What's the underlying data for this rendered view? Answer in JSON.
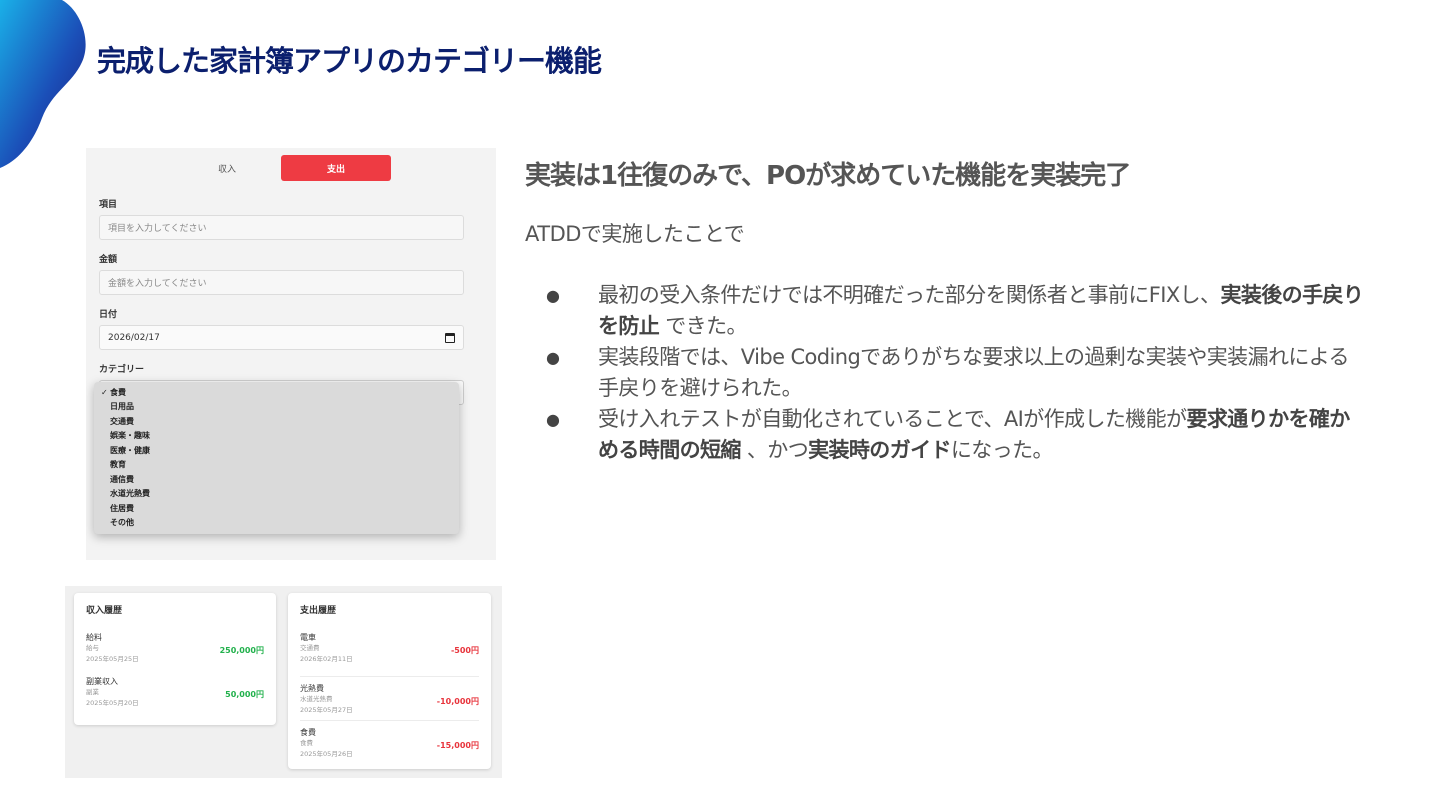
{
  "slide": {
    "title": "完成した家計簿アプリのカテゴリー機能",
    "accent_color": "#0b1f6e"
  },
  "form_screenshot": {
    "toggle_income": "収入",
    "toggle_expense": "支出",
    "expense_color": "#ee3b43",
    "item_label": "項目",
    "item_placeholder": "項目を入力してください",
    "amount_label": "金額",
    "amount_placeholder": "金額を入力してください",
    "date_label": "日付",
    "date_value": "2026/02/17",
    "category_label": "カテゴリー",
    "category_selected_mark": "✓",
    "category_options": [
      "食費",
      "日用品",
      "交通費",
      "娯楽・趣味",
      "医療・健康",
      "教育",
      "通信費",
      "水道光熱費",
      "住居費",
      "その他"
    ]
  },
  "history_screenshot": {
    "income": {
      "title": "収入履歴",
      "entries": [
        {
          "name": "給料",
          "category": "給与",
          "date": "2025年05月25日",
          "amount": "250,000円"
        },
        {
          "name": "副業収入",
          "category": "副業",
          "date": "2025年05月20日",
          "amount": "50,000円"
        }
      ]
    },
    "expense": {
      "title": "支出履歴",
      "entries": [
        {
          "name": "電車",
          "category": "交通費",
          "date": "2026年02月11日",
          "amount": "-500円"
        },
        {
          "name": "光熱費",
          "category": "水道光熱費",
          "date": "2025年05月27日",
          "amount": "-10,000円"
        },
        {
          "name": "食費",
          "category": "食費",
          "date": "2025年05月26日",
          "amount": "-15,000円"
        }
      ]
    }
  },
  "content": {
    "heading": "実装は1往復のみで、POが求めていた機能を実装完了",
    "intro": "ATDDで実施したことで",
    "bullet_mark": "●",
    "bullet1_a": "最初の受入条件だけでは不明確だった部分を関係者と事前にFIXし、",
    "bullet1_bold": "実装後の手戻りを防止",
    "bullet1_b": " できた。",
    "bullet2": "実装段階では、Vibe Codingでありがちな要求以上の過剰な実装や実装漏れによる手戻りを避けられた。",
    "bullet3_a": "受け入れテストが自動化されていることで、AIが作成した機能が",
    "bullet3_bold1": "要求通りかを確かめる時間の短縮",
    "bullet3_b": " 、かつ",
    "bullet3_bold2": "実装時のガイド",
    "bullet3_c": "になった。"
  }
}
